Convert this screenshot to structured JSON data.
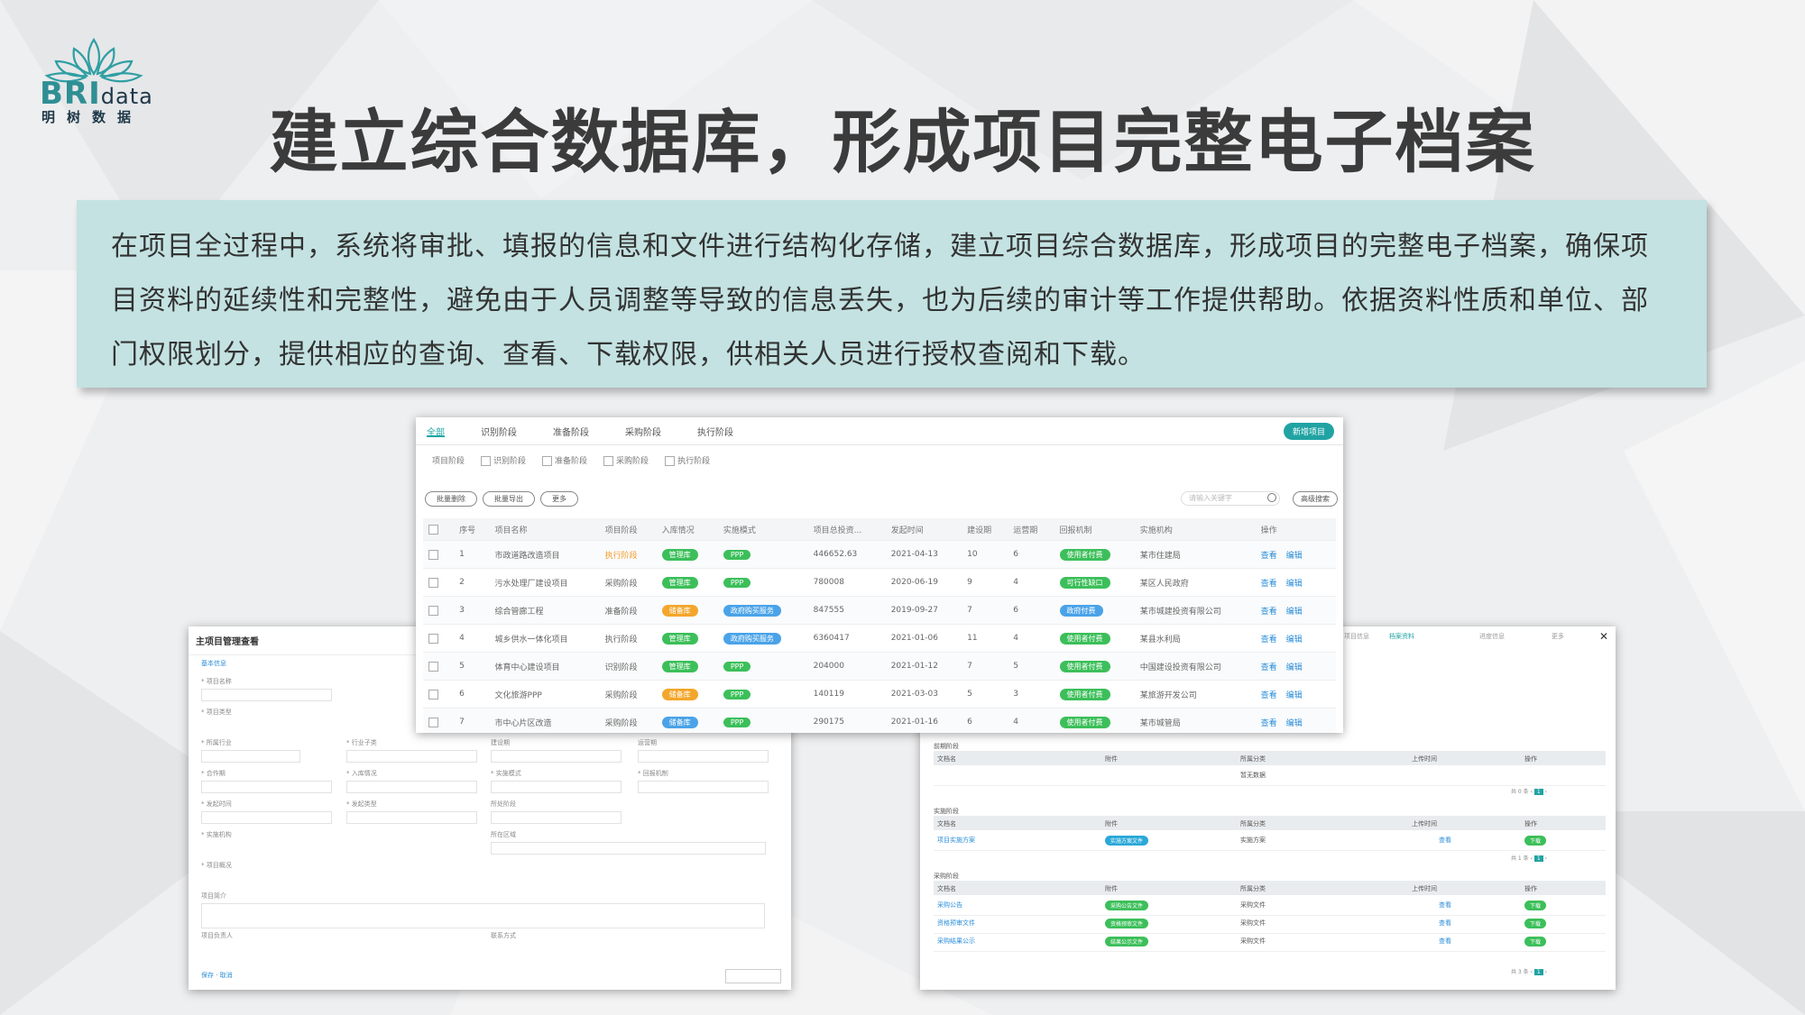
{
  "logo": {
    "brand_main": "BRI",
    "brand_sub": "data",
    "cn": "明树数据"
  },
  "title": "建立综合数据库，形成项目完整电子档案",
  "description": "在项目全过程中，系统将审批、填报的信息和文件进行结构化存储，建立项目综合数据库，形成项目的完整电子档案，确保项目资料的延续性和完整性，避免由于人员调整等导致的信息丢失，也为后续的审计等工作提供帮助。依据资料性质和单位、部门权限划分，提供相应的查询、查看、下载权限，供相关人员进行授权查阅和下载。",
  "colors": {
    "teal": "#21a3a3",
    "desc_bg": "#c4e2e2",
    "green": "#3cbf5a",
    "orange": "#f3a62b",
    "blue": "#4aa3e8"
  }
}
